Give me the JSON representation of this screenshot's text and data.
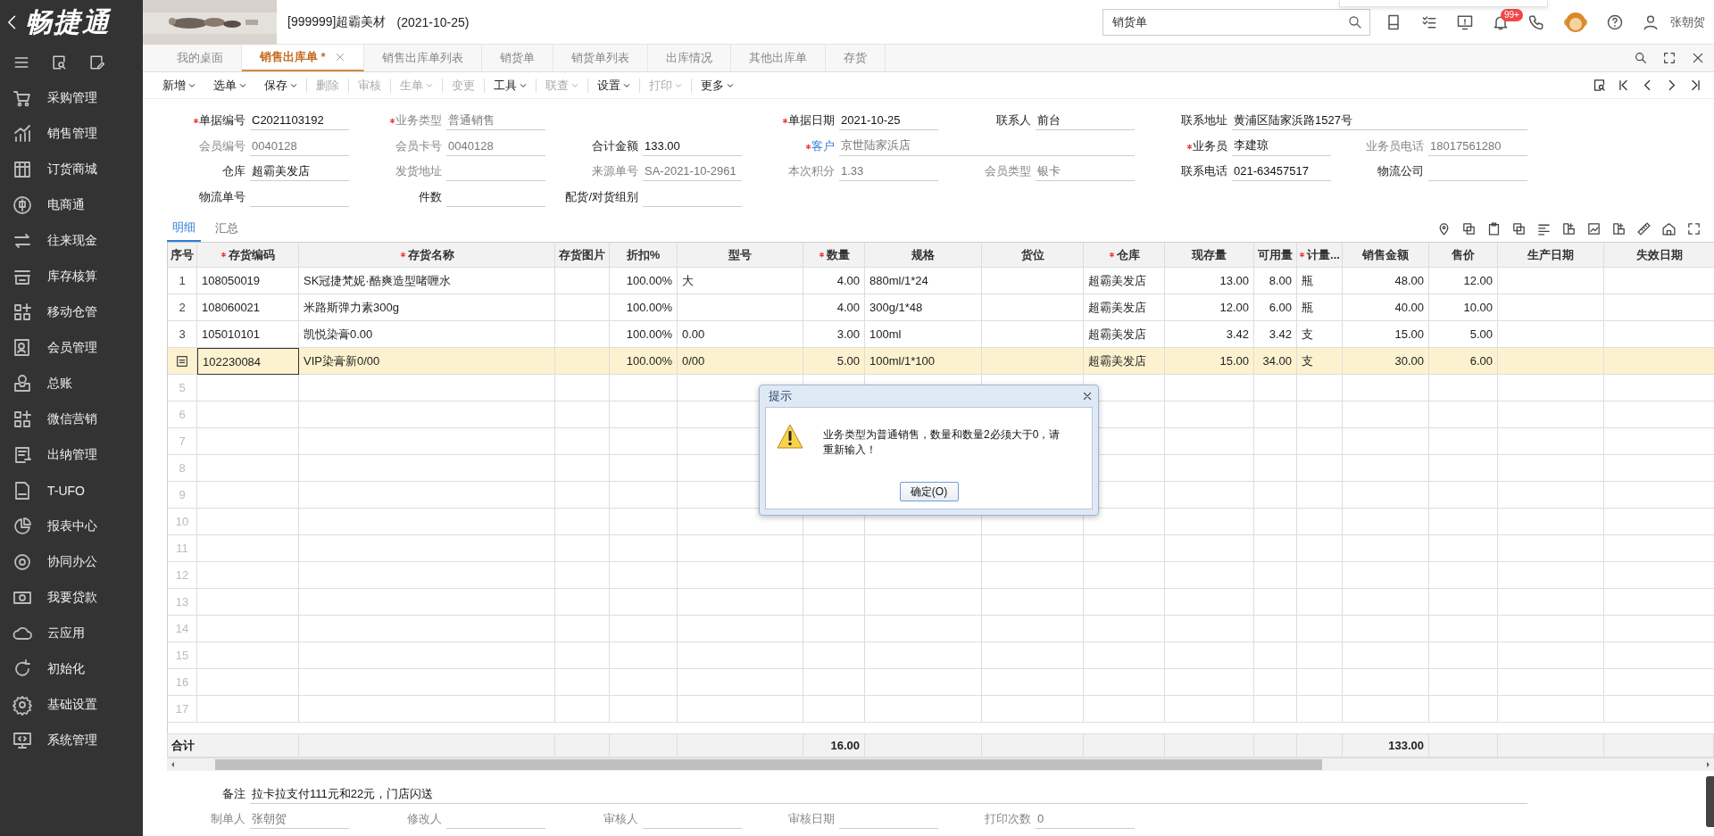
{
  "app": {
    "logo": "畅捷通",
    "company": "[999999]超霸美材",
    "date": "(2021-10-25)"
  },
  "header": {
    "search": {
      "value": "销货单"
    },
    "notifications": "99+",
    "user": "张朝贺"
  },
  "sidebar": {
    "items": [
      {
        "label": "采购管理"
      },
      {
        "label": "销售管理"
      },
      {
        "label": "订货商城"
      },
      {
        "label": "电商通"
      },
      {
        "label": "往来现金"
      },
      {
        "label": "库存核算"
      },
      {
        "label": "移动仓管"
      },
      {
        "label": "会员管理"
      },
      {
        "label": "总账"
      },
      {
        "label": "微信营销"
      },
      {
        "label": "出纳管理"
      },
      {
        "label": "T-UFO"
      },
      {
        "label": "报表中心"
      },
      {
        "label": "协同办公"
      },
      {
        "label": "我要贷款"
      },
      {
        "label": "云应用"
      },
      {
        "label": "初始化"
      },
      {
        "label": "基础设置"
      },
      {
        "label": "系统管理"
      }
    ]
  },
  "tabs": [
    {
      "label": "我的桌面",
      "selected": false,
      "closable": false
    },
    {
      "label": "销售出库单 *",
      "selected": true,
      "closable": true
    },
    {
      "label": "销售出库单列表",
      "selected": false,
      "closable": false
    },
    {
      "label": "销货单",
      "selected": false,
      "closable": false
    },
    {
      "label": "销货单列表",
      "selected": false,
      "closable": false
    },
    {
      "label": "出库情况",
      "selected": false,
      "closable": false
    },
    {
      "label": "其他出库单",
      "selected": false,
      "closable": false
    },
    {
      "label": "存货",
      "selected": false,
      "closable": false
    }
  ],
  "toolbar": [
    {
      "label": "新增",
      "menu": true,
      "disabled": false
    },
    {
      "label": "选单",
      "menu": true,
      "disabled": false
    },
    {
      "label": "保存",
      "menu": true,
      "disabled": false
    },
    {
      "label": "删除",
      "menu": false,
      "disabled": true
    },
    {
      "label": "审核",
      "menu": false,
      "disabled": true
    },
    {
      "label": "生单",
      "menu": true,
      "disabled": true
    },
    {
      "label": "变更",
      "menu": false,
      "disabled": true
    },
    {
      "label": "工具",
      "menu": true,
      "disabled": false
    },
    {
      "label": "联查",
      "menu": true,
      "disabled": true
    },
    {
      "label": "设置",
      "menu": true,
      "disabled": false
    },
    {
      "label": "打印",
      "menu": true,
      "disabled": true
    },
    {
      "label": "更多",
      "menu": true,
      "disabled": false
    }
  ],
  "form": {
    "rows": [
      [
        {
          "label": "单据编号",
          "value": "C2021103192",
          "required": true,
          "disabled": false,
          "link": false
        },
        {
          "label": "业务类型",
          "value": "普通销售",
          "required": true,
          "disabled": true,
          "link": false
        },
        null,
        {
          "label": "单据日期",
          "value": "2021-10-25",
          "required": true,
          "disabled": false,
          "link": false
        },
        {
          "label": "联系人",
          "value": "前台",
          "required": false,
          "disabled": false,
          "link": false
        },
        {
          "label": "联系地址",
          "value": "黄浦区陆家浜路1527号",
          "required": false,
          "disabled": false,
          "link": false,
          "wide": true
        }
      ],
      [
        {
          "label": "会员编号",
          "value": "0040128",
          "required": false,
          "disabled": true,
          "link": false
        },
        {
          "label": "会员卡号",
          "value": "0040128",
          "required": false,
          "disabled": true,
          "link": false
        },
        {
          "label": "合计金额",
          "value": "133.00",
          "required": false,
          "disabled": false,
          "link": false
        },
        {
          "label": "客户",
          "value": "京世陆家浜店",
          "required": true,
          "disabled": true,
          "link": true,
          "wide": true
        },
        null,
        {
          "label": "业务员",
          "value": "李建琼",
          "required": true,
          "disabled": false,
          "link": false
        },
        {
          "label": "业务员电话",
          "value": "18017561280",
          "required": false,
          "disabled": true,
          "link": false
        }
      ],
      [
        {
          "label": "仓库",
          "value": "超霸美发店",
          "required": false,
          "disabled": false,
          "link": false
        },
        {
          "label": "发货地址",
          "required": false,
          "disabled": true,
          "link": false
        },
        {
          "label": "来源单号",
          "value": "SA-2021-10-2961",
          "required": false,
          "disabled": true,
          "link": false
        },
        {
          "label": "本次积分",
          "value": "1.33",
          "required": false,
          "disabled": true,
          "link": false
        },
        {
          "label": "会员类型",
          "value": "银卡",
          "required": false,
          "disabled": true,
          "link": false
        },
        {
          "label": "联系电话",
          "value": "021-63457517",
          "required": false,
          "disabled": false,
          "link": false
        },
        {
          "label": "物流公司",
          "required": false,
          "disabled": false,
          "link": false
        }
      ],
      [
        {
          "label": "物流单号",
          "required": false,
          "disabled": false,
          "link": false
        },
        {
          "label": "件数",
          "required": false,
          "disabled": false,
          "link": false
        },
        {
          "label": "配货/对货组别",
          "required": false,
          "disabled": false,
          "link": false
        }
      ]
    ]
  },
  "detail_tabs": [
    {
      "label": "明细",
      "selected": true
    },
    {
      "label": "汇总",
      "selected": false
    }
  ],
  "table": {
    "columns": [
      {
        "label": "序号",
        "kind": "index",
        "required": false
      },
      {
        "label": "存货编码",
        "kind": "text",
        "required": true
      },
      {
        "label": "存货名称",
        "kind": "text",
        "required": true
      },
      {
        "label": "存货图片",
        "required": false
      },
      {
        "label": "折扣%",
        "kind": "number",
        "required": false
      },
      {
        "label": "型号",
        "kind": "text",
        "required": false
      },
      {
        "label": "数量",
        "kind": "number",
        "required": true
      },
      {
        "label": "规格",
        "kind": "text",
        "required": false
      },
      {
        "label": "货位",
        "kind": "text",
        "required": false
      },
      {
        "label": "仓库",
        "kind": "text",
        "required": true
      },
      {
        "label": "现存量",
        "kind": "number",
        "required": false
      },
      {
        "label": "可用量",
        "kind": "number",
        "required": false
      },
      {
        "label": "计量...",
        "kind": "text",
        "required": true
      },
      {
        "label": "销售金额",
        "kind": "number",
        "required": false
      },
      {
        "label": "售价",
        "kind": "number",
        "required": false
      },
      {
        "label": "生产日期",
        "kind": "text",
        "required": false
      },
      {
        "label": "失效日期",
        "kind": "text",
        "required": false
      }
    ],
    "rows": [
      {
        "no": "1",
        "selected": false,
        "cells": [
          "108050019",
          "SK冠捷梵妮·酷爽造型啫喱水",
          null,
          "100.00%",
          "大",
          "4.00",
          "880ml/1*24",
          null,
          "超霸美发店",
          "13.00",
          "8.00",
          "瓶",
          "48.00",
          "12.00",
          null,
          null
        ]
      },
      {
        "no": "2",
        "selected": false,
        "cells": [
          "108060021",
          "米路斯弹力素300g",
          null,
          "100.00%",
          null,
          "4.00",
          "300g/1*48",
          null,
          "超霸美发店",
          "12.00",
          "6.00",
          "瓶",
          "40.00",
          "10.00",
          null,
          null
        ]
      },
      {
        "no": "3",
        "selected": false,
        "cells": [
          "105010101",
          "凯悦染膏0.00",
          null,
          "100.00%",
          "0.00",
          "3.00",
          "100ml",
          null,
          "超霸美发店",
          "3.42",
          "3.42",
          "支",
          "15.00",
          "5.00",
          null,
          null
        ]
      },
      {
        "selected": true,
        "cells": [
          "102230084",
          "VIP染膏新0/00",
          null,
          "100.00%",
          "0/00",
          "5.00",
          "100ml/1*100",
          null,
          "超霸美发店",
          "15.00",
          "34.00",
          "支",
          "30.00",
          "6.00",
          null,
          null
        ]
      },
      {
        "no": "5",
        "selected": false
      },
      {
        "no": "6",
        "selected": false
      },
      {
        "no": "7",
        "selected": false
      },
      {
        "no": "8",
        "selected": false
      },
      {
        "no": "9",
        "selected": false
      },
      {
        "no": "10",
        "selected": false
      },
      {
        "no": "11",
        "selected": false
      },
      {
        "no": "12",
        "selected": false
      },
      {
        "no": "13",
        "selected": false
      },
      {
        "no": "14",
        "selected": false
      },
      {
        "no": "15",
        "selected": false
      },
      {
        "no": "16",
        "selected": false
      },
      {
        "no": "17",
        "selected": false
      }
    ],
    "total": {
      "label": "合计",
      "cells": [
        null,
        null,
        null,
        null,
        "16.00",
        null,
        null,
        null,
        null,
        null,
        null,
        "133.00",
        null,
        null,
        null
      ]
    }
  },
  "footer": {
    "note": {
      "label": "备注",
      "value": "拉卡拉支付111元和22元，门店闪送"
    },
    "fields": [
      {
        "label": "制单人",
        "value": "张朝贺",
        "disabled": true
      },
      {
        "label": "修改人",
        "disabled": true
      },
      {
        "label": "审核人",
        "disabled": true
      },
      {
        "label": "审核日期",
        "disabled": true
      },
      {
        "label": "打印次数",
        "value": "0",
        "disabled": true
      }
    ]
  },
  "dialog": {
    "title": "提示",
    "message": "业务类型为普通销售，数量和数量2必须大于0，请重新输入！",
    "button": "确定(O)"
  }
}
